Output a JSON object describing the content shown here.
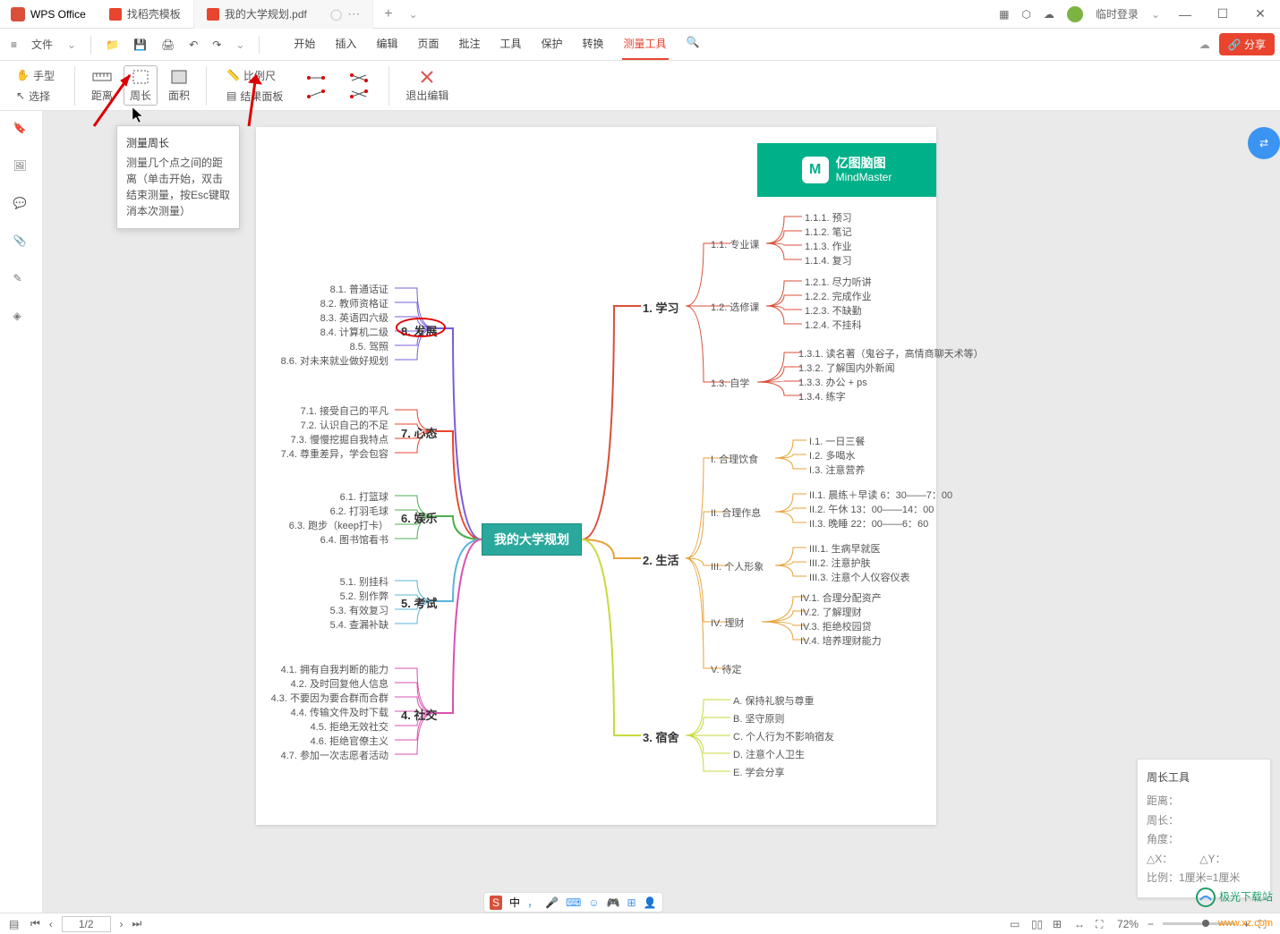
{
  "app": {
    "name": "WPS Office"
  },
  "tabs": [
    {
      "label": "找稻壳模板",
      "iconColor": "#e8442e"
    },
    {
      "label": "我的大学规划.pdf",
      "iconColor": "#e8442e",
      "active": true
    }
  ],
  "titlebar_right": {
    "login": "临时登录"
  },
  "menubar": {
    "file": "文件",
    "tabs": [
      "开始",
      "插入",
      "编辑",
      "页面",
      "批注",
      "工具",
      "保护",
      "转换",
      "测量工具"
    ],
    "active_tab": "测量工具",
    "share": "分享"
  },
  "ribbon": {
    "group1": {
      "hand": "手型",
      "select": "选择"
    },
    "group2": {
      "distance": "距离",
      "perimeter": "周长",
      "area": "面积"
    },
    "group3": {
      "scale": "比例尺",
      "results": "结果面板"
    },
    "group4": {
      "exit": "退出编辑"
    }
  },
  "tooltip": {
    "title": "测量周长",
    "body": "测量几个点之间的距离（单击开始，双击结束测量，按Esc键取消本次测量）"
  },
  "result_panel": {
    "title": "周长工具",
    "distance_label": "距离：",
    "perimeter_label": "周长：",
    "angle_label": "角度：",
    "dx": "△X：",
    "dy": "△Y：",
    "ratio": "比例：1厘米=1厘米"
  },
  "status": {
    "page": "1/2",
    "zoom": "72%"
  },
  "ime": {
    "zhong": "中"
  },
  "branding": {
    "jg": "极光下载站",
    "xz": "www.xz.com"
  },
  "mindmap": {
    "brand_cn": "亿图脑图",
    "brand_en": "MindMaster",
    "center": "我的大学规划",
    "branches": {
      "b1": {
        "label": "1. 学习",
        "children": [
          {
            "label": "1.1. 专业课",
            "children": [
              "1.1.1. 预习",
              "1.1.2. 笔记",
              "1.1.3. 作业",
              "1.1.4. 复习"
            ]
          },
          {
            "label": "1.2. 选修课",
            "children": [
              "1.2.1. 尽力听讲",
              "1.2.2. 完成作业",
              "1.2.3. 不缺勤",
              "1.2.4. 不挂科"
            ]
          },
          {
            "label": "1.3. 自学",
            "children": [
              "1.3.1. 读名著（鬼谷子，高情商聊天术等）",
              "1.3.2. 了解国内外新闻",
              "1.3.3. 办公 + ps",
              "1.3.4. 练字"
            ]
          }
        ]
      },
      "b2": {
        "label": "2. 生活",
        "children": [
          {
            "label": "I. 合理饮食",
            "children": [
              "I.1. 一日三餐",
              "I.2. 多喝水",
              "I.3. 注意营养"
            ]
          },
          {
            "label": "II. 合理作息",
            "children": [
              "II.1. 晨练＋早读 6：30——7：00",
              "II.2. 午休 13：00——14：00",
              "II.3. 晚睡 22：00——6：60"
            ]
          },
          {
            "label": "III. 个人形象",
            "children": [
              "III.1. 生病早就医",
              "III.2. 注意护肤",
              "III.3. 注意个人仪容仪表"
            ]
          },
          {
            "label": "IV. 理财",
            "children": [
              "IV.1. 合理分配资产",
              "IV.2. 了解理财",
              "IV.3. 拒绝校园贷",
              "IV.4. 培养理财能力"
            ]
          },
          {
            "label": "V. 待定",
            "children": []
          }
        ]
      },
      "b3": {
        "label": "3. 宿舍",
        "children": [
          {
            "label": "A. 保持礼貌与尊重"
          },
          {
            "label": "B. 坚守原则"
          },
          {
            "label": "C. 个人行为不影响宿友"
          },
          {
            "label": "D. 注意个人卫生"
          },
          {
            "label": "E. 学会分享"
          }
        ]
      },
      "b4": {
        "label": "4. 社交",
        "children": [
          {
            "label": "4.1. 拥有自我判断的能力"
          },
          {
            "label": "4.2. 及时回复他人信息"
          },
          {
            "label": "4.3. 不要因为要合群而合群"
          },
          {
            "label": "4.4. 传输文件及时下载"
          },
          {
            "label": "4.5. 拒绝无效社交"
          },
          {
            "label": "4.6. 拒绝官僚主义"
          },
          {
            "label": "4.7. 参加一次志愿者活动"
          }
        ]
      },
      "b5": {
        "label": "5. 考试",
        "children": [
          {
            "label": "5.1. 别挂科"
          },
          {
            "label": "5.2. 别作弊"
          },
          {
            "label": "5.3. 有效复习"
          },
          {
            "label": "5.4. 查漏补缺"
          }
        ]
      },
      "b6": {
        "label": "6. 娱乐",
        "children": [
          {
            "label": "6.1. 打篮球"
          },
          {
            "label": "6.2. 打羽毛球"
          },
          {
            "label": "6.3. 跑步（keep打卡）"
          },
          {
            "label": "6.4. 图书馆看书"
          }
        ]
      },
      "b7": {
        "label": "7. 心态",
        "children": [
          {
            "label": "7.1. 接受自己的平凡"
          },
          {
            "label": "7.2. 认识自己的不足"
          },
          {
            "label": "7.3. 慢慢挖掘自我特点"
          },
          {
            "label": "7.4. 尊重差异，学会包容"
          }
        ]
      },
      "b8": {
        "label": "8. 发展",
        "children": [
          {
            "label": "8.1. 普通话证"
          },
          {
            "label": "8.2. 教师资格证"
          },
          {
            "label": "8.3. 英语四六级"
          },
          {
            "label": "8.4. 计算机二级"
          },
          {
            "label": "8.5. 驾照"
          },
          {
            "label": "8.6. 对未来就业做好规划"
          }
        ]
      }
    }
  }
}
